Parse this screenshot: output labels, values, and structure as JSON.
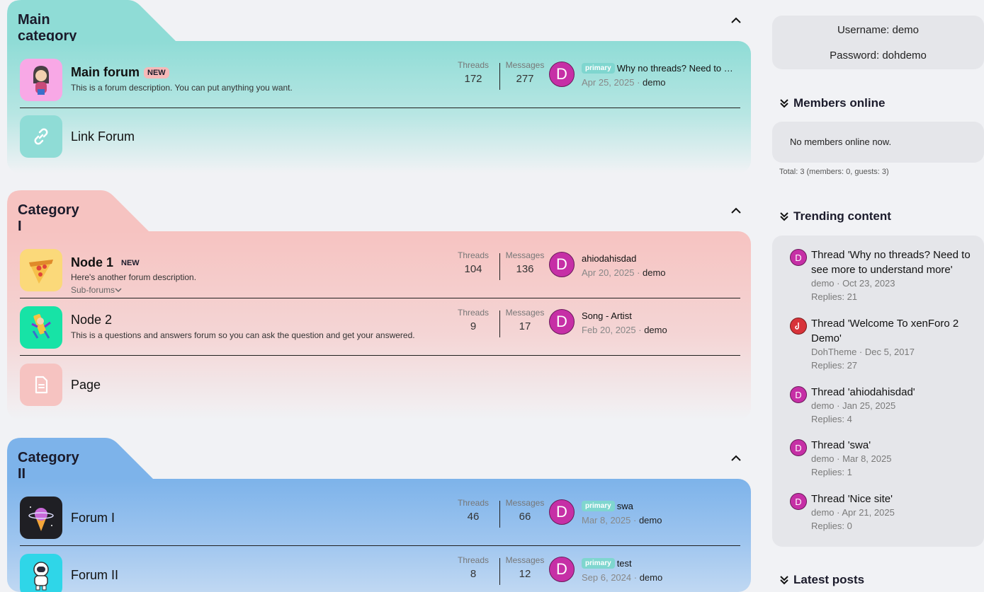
{
  "categories": [
    {
      "title": "Main category",
      "nodes": [
        {
          "title": "Main forum",
          "badge": "NEW",
          "desc": "This is a forum description. You can put anything you want.",
          "threads_label": "Threads",
          "threads": "172",
          "messages_label": "Messages",
          "messages": "277",
          "avatar": "D",
          "prefix": "primary",
          "last_title": "Why no threads? Need to s…",
          "last_date": "Apr 25, 2025",
          "last_user": "demo"
        },
        {
          "title": "Link Forum"
        }
      ]
    },
    {
      "title": "Category I",
      "nodes": [
        {
          "title": "Node 1",
          "badge": "NEW",
          "desc": "Here's another forum description.",
          "sub": "Sub-forums",
          "threads_label": "Threads",
          "threads": "104",
          "messages_label": "Messages",
          "messages": "136",
          "avatar": "D",
          "last_title": "ahiodahisdad",
          "last_date": "Apr 20, 2025",
          "last_user": "demo"
        },
        {
          "title": "Node 2",
          "desc": "This is a questions and answers forum so you can ask the question and get your answered.",
          "threads_label": "Threads",
          "threads": "9",
          "messages_label": "Messages",
          "messages": "17",
          "avatar": "D",
          "last_title": "Song - Artist",
          "last_date": "Feb 20, 2025",
          "last_user": "demo"
        },
        {
          "title": "Page"
        }
      ]
    },
    {
      "title": "Category II",
      "nodes": [
        {
          "title": "Forum I",
          "threads_label": "Threads",
          "threads": "46",
          "messages_label": "Messages",
          "messages": "66",
          "avatar": "D",
          "prefix": "primary",
          "last_title": "swa",
          "last_date": "Mar 8, 2025",
          "last_user": "demo"
        },
        {
          "title": "Forum II",
          "threads_label": "Threads",
          "threads": "8",
          "messages_label": "Messages",
          "messages": "12",
          "avatar": "D",
          "prefix": "primary",
          "last_title": "test",
          "last_date": "Sep 6, 2024",
          "last_user": "demo"
        }
      ]
    }
  ],
  "sidebar": {
    "login": {
      "username": "Username: demo",
      "password": "Password: dohdemo"
    },
    "members_online": {
      "title": "Members online",
      "empty": "No members online now.",
      "total": "Total: 3 (members: 0, guests: 3)"
    },
    "trending": {
      "title": "Trending content",
      "items": [
        {
          "avatar": "D",
          "title": "Thread 'Why no threads? Need to see more to understand more'",
          "meta": "demo · Oct 23, 2023",
          "replies": "Replies: 21"
        },
        {
          "avatar": "",
          "title": "Thread 'Welcome To xenForo 2 Demo'",
          "meta": "DohTheme · Dec 5, 2017",
          "replies": "Replies: 27"
        },
        {
          "avatar": "D",
          "title": "Thread 'ahiodahisdad'",
          "meta": "demo · Jan 25, 2025",
          "replies": "Replies: 4"
        },
        {
          "avatar": "D",
          "title": "Thread 'swa'",
          "meta": "demo · Mar 8, 2025",
          "replies": "Replies: 1"
        },
        {
          "avatar": "D",
          "title": "Thread 'Nice site'",
          "meta": "demo · Apr 21, 2025",
          "replies": "Replies: 0"
        }
      ]
    },
    "latest_posts": {
      "title": "Latest posts"
    }
  },
  "colors": {
    "main_category": "#8fdcd6",
    "category_i": "#f6c3c1",
    "category_ii": "#7db3ea",
    "avatar": "#c62fa6",
    "primary_badge": "#7fd6cf"
  }
}
